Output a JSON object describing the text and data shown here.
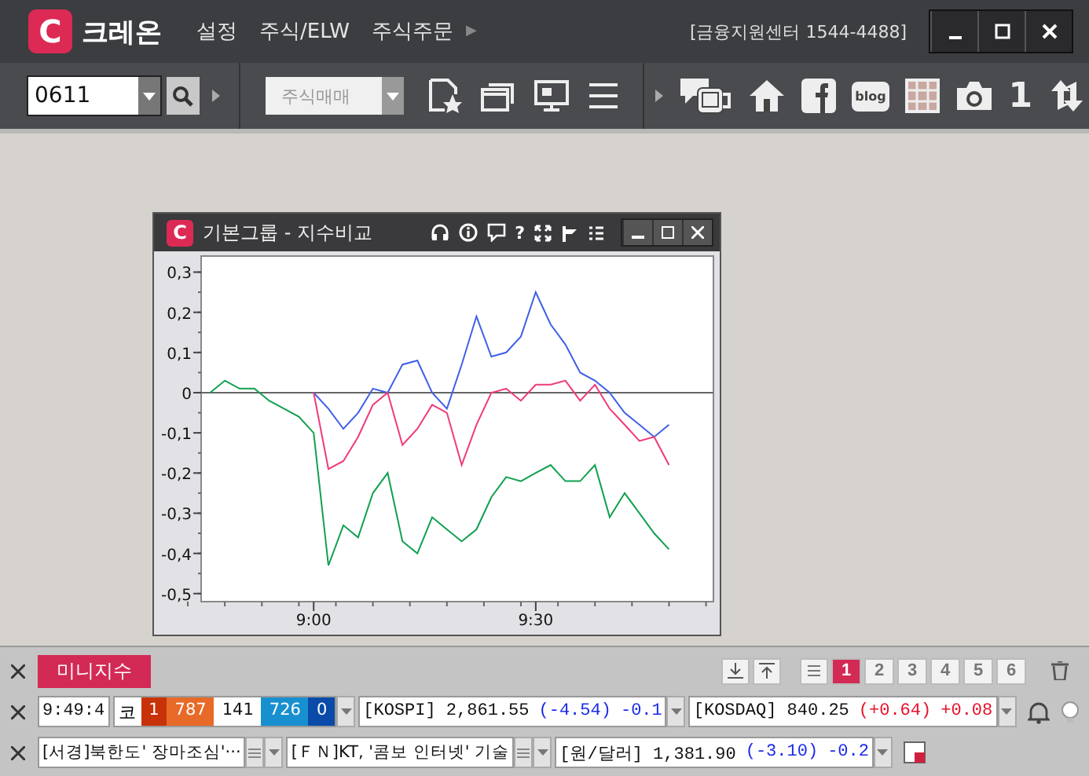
{
  "app": {
    "logo": "C",
    "name": "크레온",
    "menu": [
      "설정",
      "주식/ELW",
      "주식주문"
    ],
    "menu_more": "▶",
    "support": "[금융지원센터 1544-4488]"
  },
  "toolbar": {
    "screen_code": "0611",
    "order_combo": "주식매매",
    "blog_label": "blog",
    "layout_number": "1"
  },
  "chart_window": {
    "logo": "C",
    "title": "기본그룹 - 지수비교",
    "help_glyph": "?",
    "chart_data": {
      "type": "line",
      "categories": [
        null,
        null,
        null,
        null,
        null,
        null,
        null,
        "9:00",
        null,
        null,
        null,
        null,
        null,
        null,
        null,
        null,
        null,
        null,
        null,
        null,
        null,
        null,
        "9:30",
        null,
        null,
        null,
        null,
        null,
        null,
        null,
        null,
        null
      ],
      "ylim": [
        -0.52,
        0.34
      ],
      "yticks": [
        {
          "value": 0.3,
          "label": "0,3"
        },
        {
          "value": 0.2,
          "label": "0,2"
        },
        {
          "value": 0.1,
          "label": "0,1"
        },
        {
          "value": 0,
          "label": "0"
        },
        {
          "value": -0.1,
          "label": "-0,1"
        },
        {
          "value": -0.2,
          "label": "-0,2"
        },
        {
          "value": -0.3,
          "label": "-0,3"
        },
        {
          "value": -0.4,
          "label": "-0,4"
        },
        {
          "value": -0.5,
          "label": "-0,5"
        }
      ],
      "series": [
        {
          "color": "#4060e8",
          "values": [
            null,
            null,
            null,
            null,
            null,
            null,
            null,
            0,
            -0.04,
            -0.09,
            -0.05,
            0.01,
            0.0,
            0.07,
            0.08,
            0.0,
            -0.04,
            0.07,
            0.19,
            0.09,
            0.1,
            0.14,
            0.25,
            0.17,
            0.12,
            0.05,
            0.03,
            0.0,
            -0.05,
            -0.08,
            -0.11,
            -0.08
          ]
        },
        {
          "color": "#f03a7a",
          "values": [
            null,
            null,
            null,
            null,
            null,
            null,
            null,
            0,
            -0.19,
            -0.17,
            -0.11,
            -0.03,
            0.0,
            -0.13,
            -0.09,
            -0.03,
            -0.05,
            -0.18,
            -0.08,
            0.0,
            0.01,
            -0.02,
            0.02,
            0.02,
            0.03,
            -0.02,
            0.02,
            -0.04,
            -0.08,
            -0.12,
            -0.11,
            -0.18
          ]
        },
        {
          "color": "#10a050",
          "values": [
            0,
            0.03,
            0.01,
            0.01,
            -0.02,
            -0.04,
            -0.06,
            -0.1,
            -0.43,
            -0.33,
            -0.36,
            -0.25,
            -0.2,
            -0.37,
            -0.4,
            -0.31,
            -0.34,
            -0.37,
            -0.34,
            -0.26,
            -0.21,
            -0.22,
            -0.2,
            -0.18,
            -0.22,
            -0.22,
            -0.18,
            -0.31,
            -0.25,
            -0.3,
            -0.35,
            -0.39
          ]
        }
      ]
    }
  },
  "mini_panel": {
    "title": "미니지수",
    "pages": [
      {
        "label": "1",
        "selected": true
      },
      {
        "label": "2",
        "selected": false
      },
      {
        "label": "3",
        "selected": false
      },
      {
        "label": "4",
        "selected": false
      },
      {
        "label": "5",
        "selected": false
      },
      {
        "label": "6",
        "selected": false
      }
    ],
    "time": "9:49:4",
    "market": "코",
    "breadth": [
      {
        "value": "1",
        "color": "#c83208"
      },
      {
        "value": "787",
        "color": "#e86a28"
      },
      {
        "value": "141",
        "color": "#ffffff"
      },
      {
        "value": "726",
        "color": "#1890d0"
      },
      {
        "value": "0",
        "color": "#0a4aa8"
      }
    ],
    "tickers": [
      {
        "name": "[KOSPI]",
        "price": "2,861.55",
        "change": "(-4.54)",
        "rate": "-0.1",
        "color": "#1a2ae8"
      },
      {
        "name": "[KOSDAQ]",
        "price": "840.25",
        "change": "(+0.64)",
        "rate": "+0.08",
        "color": "#e8102a"
      }
    ],
    "news": [
      "[서경]북한도' 장마조심'···",
      "[ＦＮ]KT, '콤보 인터넷' 기술"
    ],
    "fx": {
      "name": "[원/달러]",
      "price": "1,381.90",
      "change": "(-3.10)",
      "rate": "-0.2",
      "color": "#1a2ae8"
    }
  }
}
